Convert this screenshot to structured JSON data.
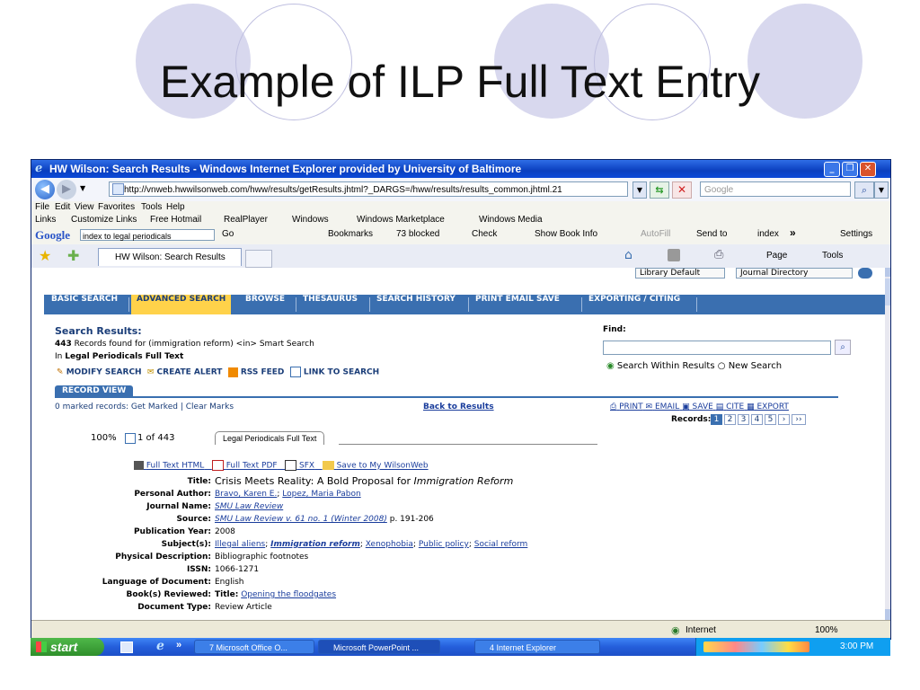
{
  "slide": {
    "title": "Example of ILP Full Text Entry"
  },
  "window": {
    "title": "HW Wilson: Search Results - Windows Internet Explorer provided by University of Baltimore",
    "url": "http://vnweb.hwwilsonweb.com/hww/results/getResults.jhtml?_DARGS=/hww/results/results_common.jhtml.21",
    "search_placeholder": "Google",
    "menu": [
      "File",
      "Edit",
      "View",
      "Favorites",
      "Tools",
      "Help"
    ],
    "links_bar": {
      "label": "Links",
      "items": [
        "Customize Links",
        "Free Hotmail",
        "RealPlayer",
        "Windows",
        "Windows Marketplace",
        "Windows Media"
      ]
    },
    "google_bar": {
      "logo": "Google",
      "query": "index to legal periodicals",
      "go": "Go",
      "bookmarks": "Bookmarks",
      "blocked": "73 blocked",
      "check": "Check",
      "book_info": "Show Book Info",
      "autofill": "AutoFill",
      "send_to": "Send to",
      "index": "index",
      "more": "»",
      "settings": "Settings"
    },
    "tab_label": "HW Wilson: Search Results",
    "cmd": {
      "page": "Page",
      "tools": "Tools"
    }
  },
  "site": {
    "top_dropdowns": [
      "Library Default",
      "Journal Directory"
    ],
    "nav": [
      "BASIC SEARCH",
      "ADVANCED SEARCH",
      "BROWSE",
      "THESAURUS",
      "SEARCH HISTORY",
      "PRINT EMAIL SAVE",
      "EXPORTING / CITING"
    ],
    "results_heading": "Search Results:",
    "record_count": "443",
    "records_text": "Records found for (immigration reform) <in> Smart Search",
    "in_label": "In",
    "database": "Legal Periodicals Full Text",
    "actions": [
      "MODIFY SEARCH",
      "CREATE ALERT",
      "RSS FEED",
      "LINK TO SEARCH"
    ],
    "find_label": "Find:",
    "radio_within": "Search Within Results",
    "radio_new": "New Search",
    "record_view_tab": "RECORD VIEW",
    "marked_text": "0 marked records:",
    "get_marked": "Get Marked",
    "pipe": "|",
    "clear_marks": "Clear Marks",
    "back_to_results": "Back to Results",
    "tools": [
      "PRINT",
      "EMAIL",
      "SAVE",
      "CITE",
      "EXPORT"
    ],
    "records_label": "Records:",
    "pages": [
      "1",
      "2",
      "3",
      "4",
      "5",
      "›",
      "››"
    ],
    "zoom_pct": "100%",
    "of_text": "1 of 443",
    "db_tab": "Legal Periodicals Full Text",
    "record_links": [
      "Full Text HTML",
      "Full Text PDF",
      "SFX",
      "Save to My WilsonWeb"
    ]
  },
  "record": {
    "title_label": "Title:",
    "title_main": "Crisis Meets Reality: A Bold Proposal for",
    "title_ital": "Immigration Reform",
    "author_label": "Personal Author:",
    "author1": "Bravo, Karen E.",
    "sep_semicolon": ";",
    "author2": "Lopez, Maria Pabon",
    "journal_label": "Journal Name:",
    "journal": "SMU Law Review",
    "source_label": "Source:",
    "source": "SMU Law Review v. 61 no. 1 (Winter 2008)",
    "source_pages": "p. 191-206",
    "year_label": "Publication Year:",
    "year": "2008",
    "subjects_label": "Subject(s):",
    "subjects": [
      "Illegal aliens",
      "Immigration reform",
      "Xenophobia",
      "Public policy",
      "Social reform"
    ],
    "physical_label": "Physical Description:",
    "physical": "Bibliographic footnotes",
    "issn_label": "ISSN:",
    "issn": "1066-1271",
    "lang_label": "Language of Document:",
    "lang": "English",
    "book_label": "Book(s) Reviewed:",
    "book_title_label": "Title:",
    "book_title": "Opening the floodgates",
    "doctype_label": "Document Type:",
    "doctype": "Review Article"
  },
  "status": {
    "zone": "Internet",
    "zoom": "100%"
  },
  "taskbar": {
    "start": "start",
    "more": "»",
    "tasks": [
      "7 Microsoft Office O...",
      "Microsoft PowerPoint ...",
      "4 Internet Explorer"
    ],
    "clock": "3:00 PM"
  },
  "colors": {
    "nav_bg": "#3a6fb0",
    "nav_active": "#ffd24a",
    "link": "#1a3d9c",
    "title_bar": "#0a3fbf"
  }
}
